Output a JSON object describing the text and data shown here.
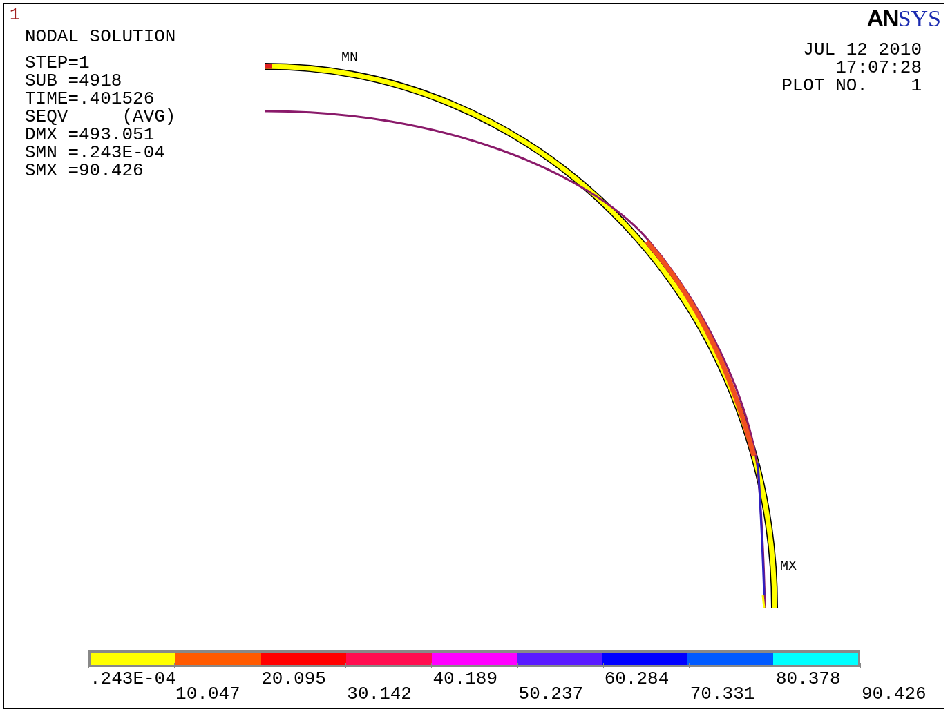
{
  "window_number": "1",
  "title": "NODAL SOLUTION",
  "info": [
    "STEP=1",
    "SUB =4918",
    "TIME=.401526",
    "SEQV     (AVG)",
    "DMX =493.051",
    "SMN =.243E-04",
    "SMX =90.426"
  ],
  "logo": {
    "dark": "AN",
    "light": "SYS"
  },
  "stamp": [
    "JUL 12 2010",
    "17:07:28",
    "PLOT NO.    1"
  ],
  "markers": {
    "min": "MN",
    "max": "MX"
  },
  "legend": {
    "bands": [
      {
        "color": "#ffff00"
      },
      {
        "color": "#ff5a00"
      },
      {
        "color": "#ff0000"
      },
      {
        "color": "#ff0e50"
      },
      {
        "color": "#ff00ff"
      },
      {
        "color": "#5a1aff"
      },
      {
        "color": "#0000ff"
      },
      {
        "color": "#005aff"
      },
      {
        "color": "#00ffff"
      }
    ],
    "labels": [
      ".243E-04",
      "10.047",
      "20.095",
      "30.142",
      "40.189",
      "50.237",
      "60.284",
      "70.331",
      "80.378",
      "90.426"
    ]
  }
}
